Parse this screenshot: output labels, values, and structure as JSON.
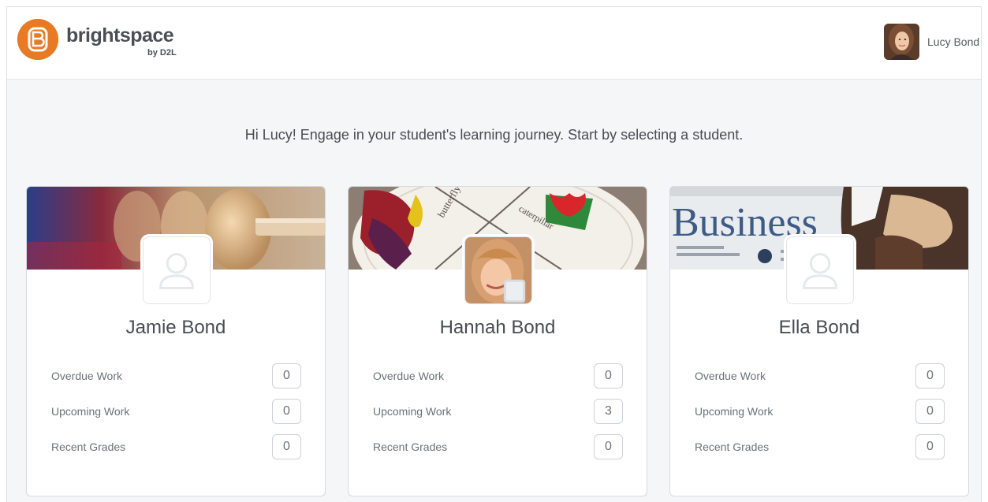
{
  "brand": {
    "name": "brightspace",
    "sub": "by D2L",
    "logo_letter": "B",
    "accent": "#e87a25"
  },
  "user": {
    "name": "Lucy Bond"
  },
  "intro": "Hi Lucy! Engage in your student's learning journey. Start by selecting a student.",
  "students": [
    {
      "name": "Jamie Bond",
      "banner": "abacus",
      "stats": [
        {
          "label": "Overdue Work",
          "value": "0"
        },
        {
          "label": "Upcoming Work",
          "value": "0"
        },
        {
          "label": "Recent Grades",
          "value": "0"
        }
      ]
    },
    {
      "name": "Hannah Bond",
      "banner": "paper-plate-craft",
      "stats": [
        {
          "label": "Overdue Work",
          "value": "0"
        },
        {
          "label": "Upcoming Work",
          "value": "3"
        },
        {
          "label": "Recent Grades",
          "value": "0"
        }
      ]
    },
    {
      "name": "Ella Bond",
      "banner": "business-newspaper",
      "banner_text": "Business",
      "stats": [
        {
          "label": "Overdue Work",
          "value": "0"
        },
        {
          "label": "Upcoming Work",
          "value": "0"
        },
        {
          "label": "Recent Grades",
          "value": "0"
        }
      ]
    }
  ]
}
